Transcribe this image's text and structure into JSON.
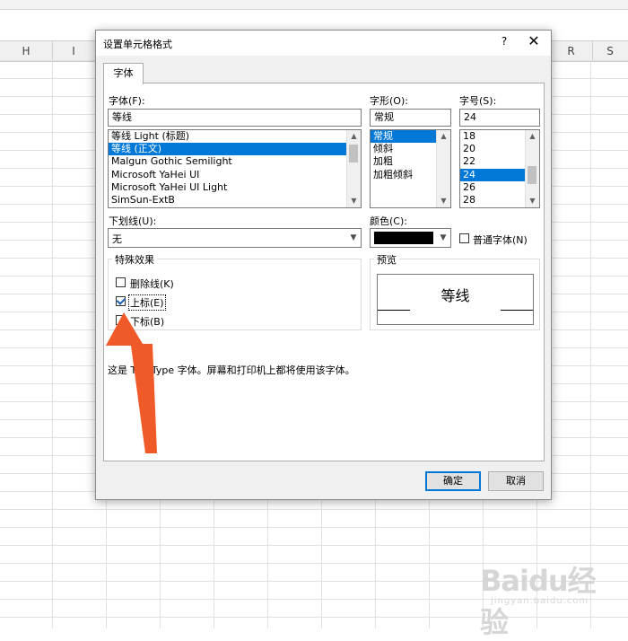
{
  "sheet": {
    "columns_left": [
      "H",
      "I"
    ],
    "columns_right": [
      "R",
      "S"
    ]
  },
  "dialog": {
    "title": "设置单元格格式",
    "help_button": "?",
    "close_button": "✕",
    "tab_font": "字体",
    "font_label": "字体(F):",
    "font_value": "等线",
    "font_list": [
      "等线 Light (标题)",
      "等线 (正文)",
      "Malgun Gothic Semilight",
      "Microsoft YaHei UI",
      "Microsoft YaHei UI Light",
      "SimSun-ExtB"
    ],
    "font_selected_index": 1,
    "style_label": "字形(O):",
    "style_value": "常规",
    "style_list": [
      "常规",
      "倾斜",
      "加粗",
      "加粗倾斜"
    ],
    "style_selected_index": 0,
    "size_label": "字号(S):",
    "size_value": "24",
    "size_list": [
      "18",
      "20",
      "22",
      "24",
      "26",
      "28"
    ],
    "size_selected_index": 3,
    "underline_label": "下划线(U):",
    "underline_value": "无",
    "color_label": "颜色(C):",
    "color_value": "#000000",
    "normal_font_label": "普通字体(N)",
    "normal_font_checked": false,
    "effects_title": "特殊效果",
    "strikethrough_label": "删除线(K)",
    "strikethrough_checked": false,
    "superscript_label": "上标(E)",
    "superscript_checked": true,
    "subscript_label": "下标(B)",
    "subscript_checked": false,
    "preview_title": "预览",
    "preview_text": "等线",
    "info_text": "这是 TrueType 字体。屏幕和打印机上都将使用该字体。",
    "ok_button": "确定",
    "cancel_button": "取消"
  },
  "annotation": {
    "arrow_color": "#f05a28"
  },
  "watermark": {
    "brand": "Baidu经验",
    "url": "jingyan.baidu.com"
  }
}
